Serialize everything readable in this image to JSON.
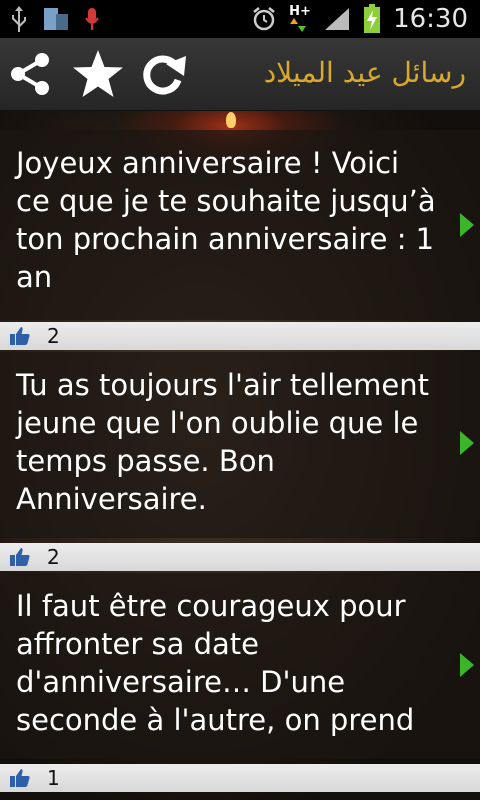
{
  "status_bar": {
    "time": "16:30",
    "network": "H+"
  },
  "toolbar": {
    "title": "رسائل عيد الميلاد",
    "share_icon": "share-icon",
    "favorite_icon": "star-icon",
    "refresh_icon": "refresh-icon"
  },
  "messages": [
    {
      "text": "Joyeux anniversaire ! Voici ce que je te souhaite jusqu’à ton prochain anniversaire : 1 an",
      "likes": "2"
    },
    {
      "text": "Tu as toujours l'air tellement jeune que l'on oublie que le temps passe. Bon Anniversaire.",
      "likes": "2"
    },
    {
      "text": "Il faut être courageux pour affronter sa date d'anniversaire… D'une seconde à l'autre, on prend",
      "likes": "1"
    }
  ],
  "colors": {
    "title": "#d8a92a",
    "arrow": "#3bb52a",
    "like_icon": "#2f5fa8"
  }
}
